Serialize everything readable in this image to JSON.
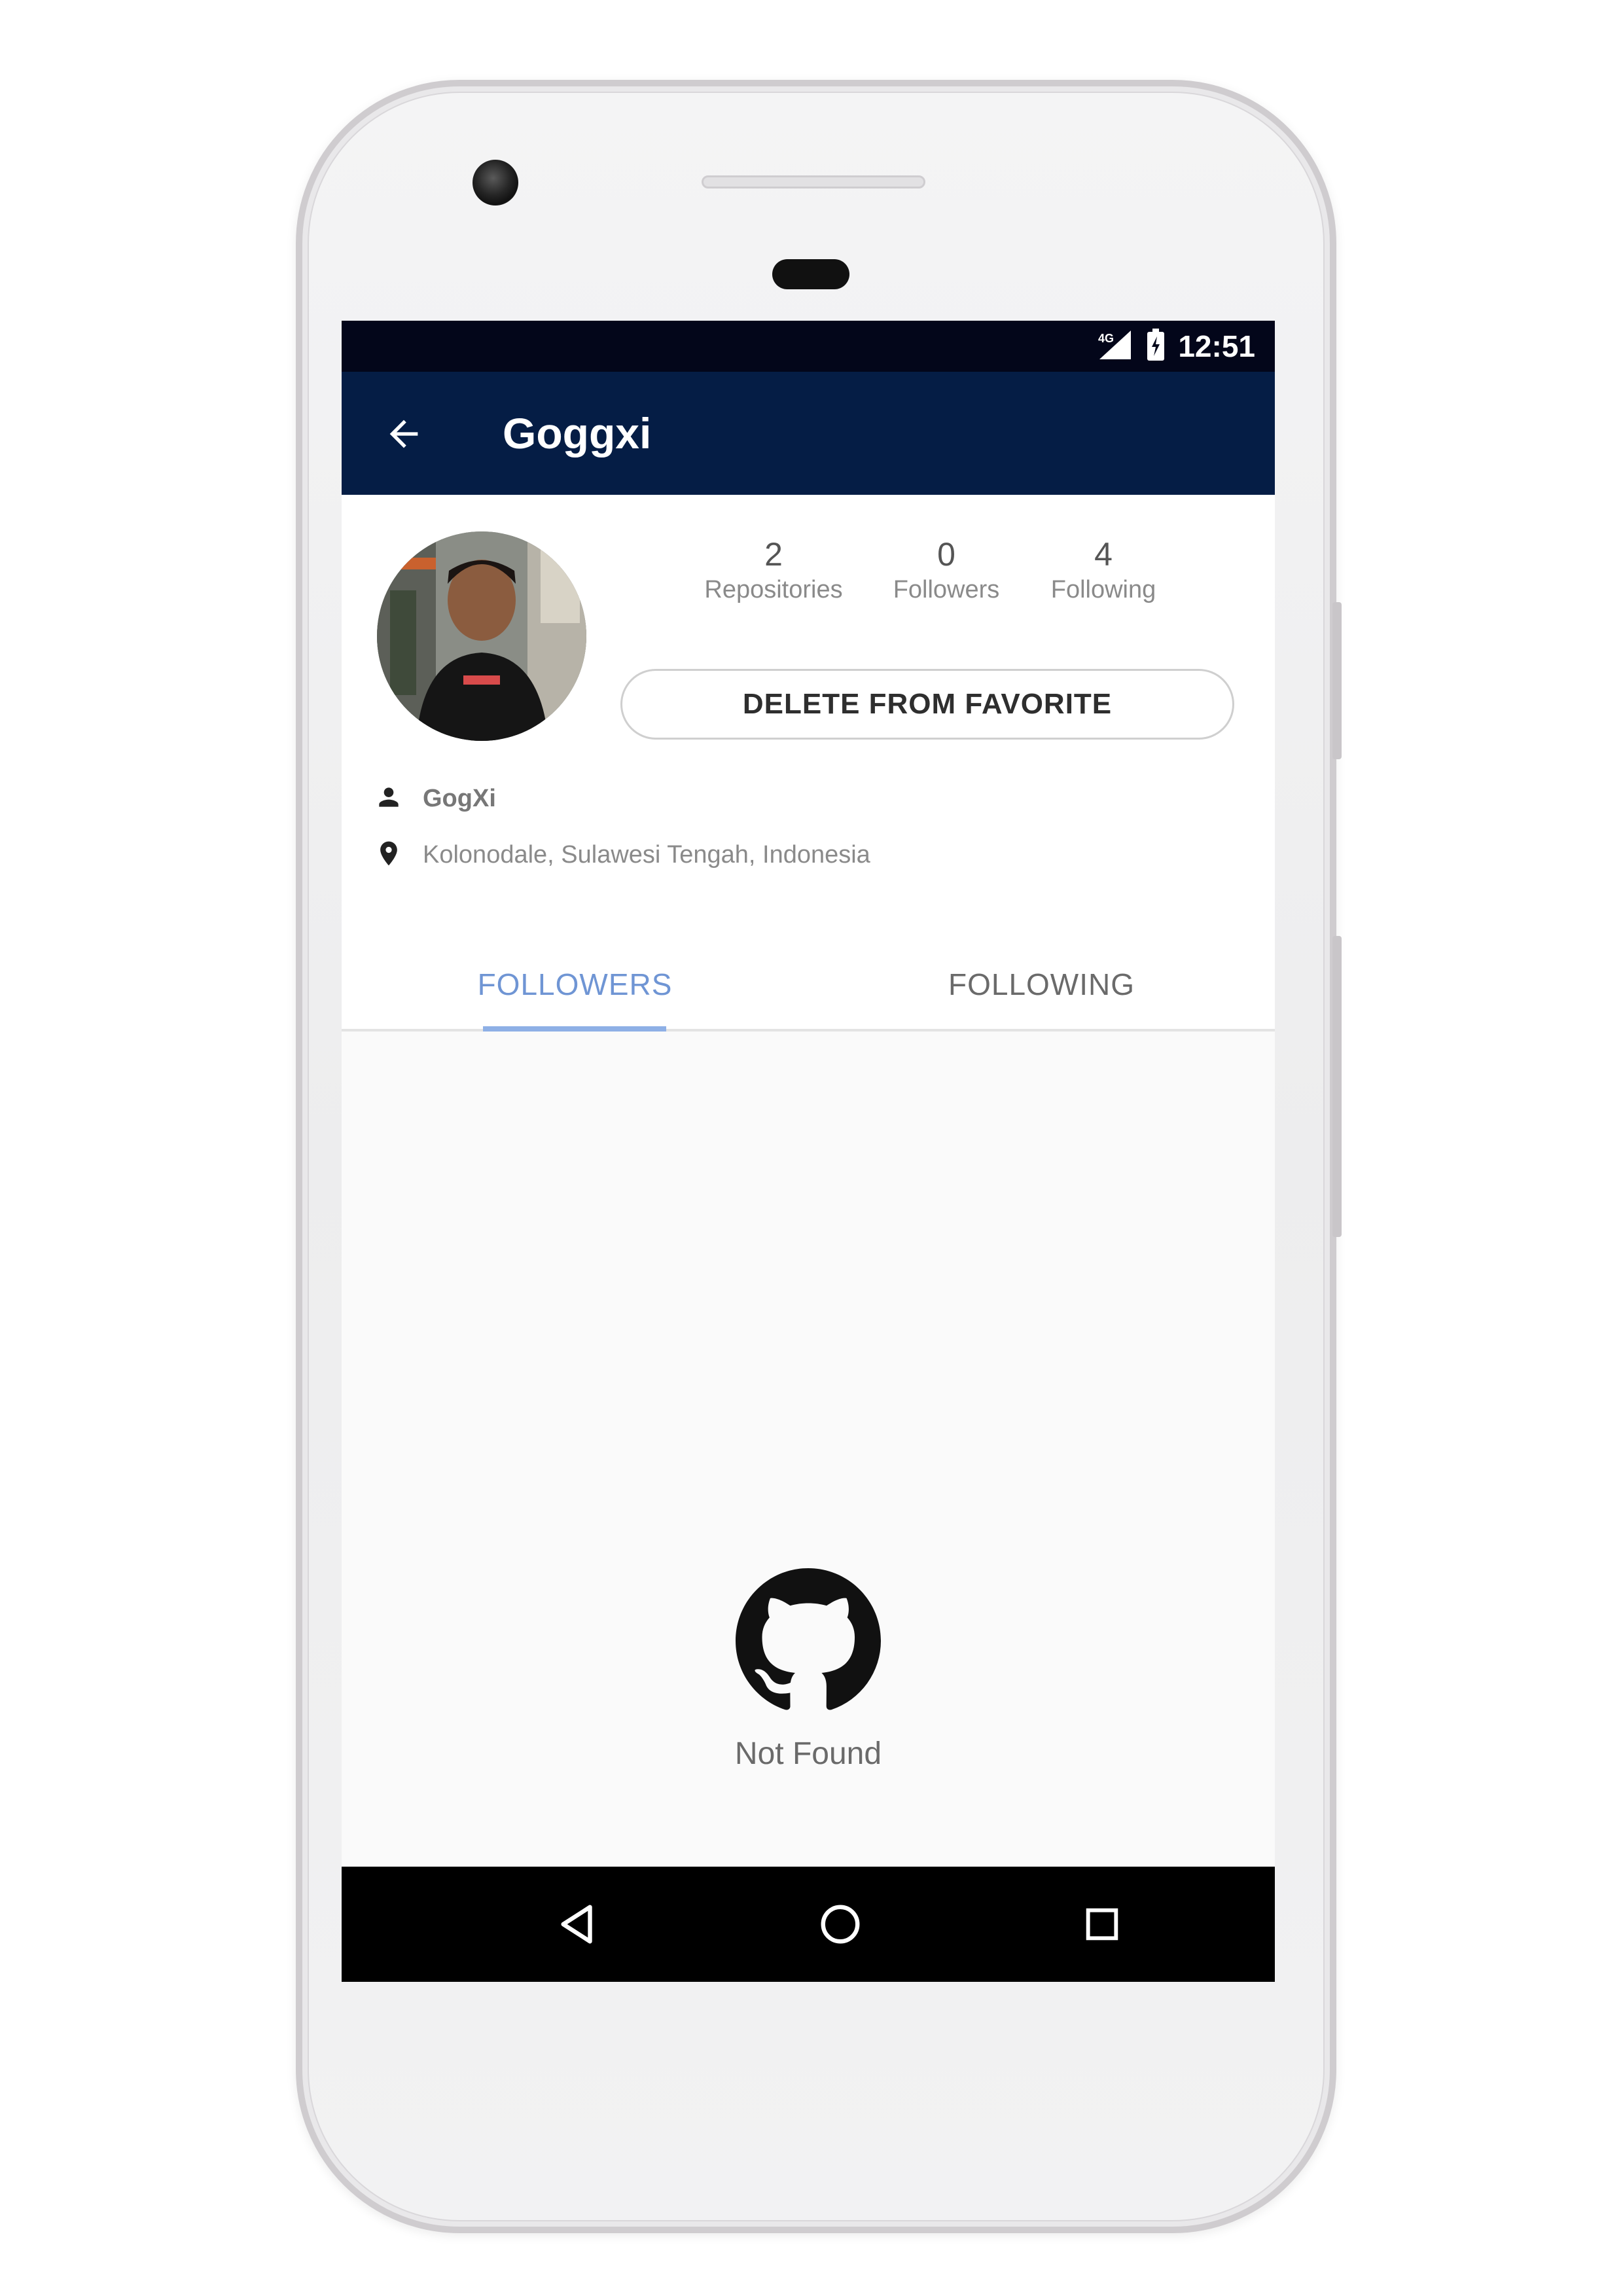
{
  "status_bar": {
    "time": "12:51",
    "icons": [
      "signal-icon",
      "battery-icon"
    ]
  },
  "toolbar": {
    "back_icon": "arrow-back-icon",
    "title": "Goggxi"
  },
  "profile": {
    "stats": [
      {
        "value": "2",
        "label": "Repositories"
      },
      {
        "value": "0",
        "label": "Followers"
      },
      {
        "value": "4",
        "label": "Following"
      }
    ],
    "favorite_button_label": "DELETE FROM FAVORITE",
    "name_icon": "person-icon",
    "name": "GogXi",
    "location_icon": "location-pin-icon",
    "location": "Kolonodale, Sulawesi Tengah, Indonesia"
  },
  "tabs": {
    "items": [
      {
        "label": "FOLLOWERS",
        "selected": true
      },
      {
        "label": "FOLLOWING",
        "selected": false
      }
    ],
    "accent_color": "#6f95d4"
  },
  "empty_state": {
    "icon": "github-icon",
    "message": "Not Found"
  },
  "nav_bar": {
    "icons": [
      "nav-back-icon",
      "nav-home-icon",
      "nav-recents-icon"
    ]
  },
  "colors": {
    "status_bar": "#03061a",
    "toolbar": "#051d45",
    "nav_bar": "#000000"
  }
}
